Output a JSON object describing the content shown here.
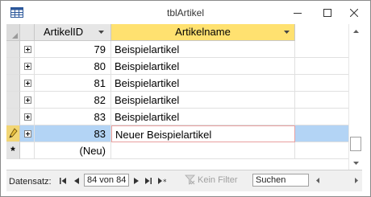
{
  "window": {
    "title": "tblArtikel",
    "icon": "table-icon",
    "controls": [
      "minimize-icon",
      "maximize-icon",
      "close-icon"
    ]
  },
  "grid": {
    "columns": [
      {
        "key": "id",
        "label": "ArtikelID"
      },
      {
        "key": "name",
        "label": "Artikelname"
      }
    ],
    "rows": [
      {
        "id": "79",
        "name": "Beispielartikel"
      },
      {
        "id": "80",
        "name": "Beispielartikel"
      },
      {
        "id": "81",
        "name": "Beispielartikel"
      },
      {
        "id": "82",
        "name": "Beispielartikel"
      },
      {
        "id": "83",
        "name": "Beispielartikel"
      },
      {
        "id": "83",
        "name": "Neuer Beispielartikel",
        "editing": true
      }
    ],
    "new_row": {
      "id": "(Neu)",
      "marker": "*"
    }
  },
  "status": {
    "label": "Datensatz:",
    "record": "84 von 84",
    "filter_label": "Kein Filter",
    "search_placeholder": "Suchen"
  },
  "colors": {
    "header_sort": "#ffe170",
    "current_row": "#b3d4f5",
    "edit_indicator": "#f2d675"
  }
}
